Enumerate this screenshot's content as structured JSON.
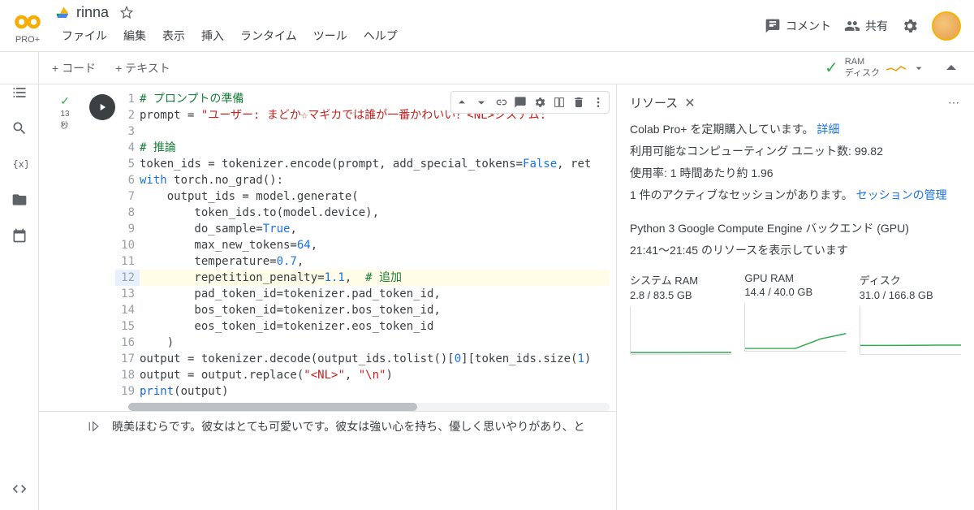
{
  "header": {
    "pro_badge": "PRO+",
    "doc_title": "rinna",
    "menus": [
      "ファイル",
      "編集",
      "表示",
      "挿入",
      "ランタイム",
      "ツール",
      "ヘルプ"
    ],
    "comment_label": "コメント",
    "share_label": "共有"
  },
  "toolbar": {
    "code_btn": "+ コード",
    "text_btn": "+ テキスト",
    "ram_label": "RAM",
    "disk_label": "ディスク"
  },
  "cell": {
    "exec_time": "13",
    "exec_unit": "秒",
    "lines": [
      {
        "n": 1,
        "html": "<span class='c-comment'># プロンプトの準備</span>"
      },
      {
        "n": 2,
        "html": "prompt = <span class='c-str'>\"ユーザー: まどか☆マギカでは誰が一番かわいい？&lt;NL&gt;システム: \"</span>"
      },
      {
        "n": 3,
        "html": ""
      },
      {
        "n": 4,
        "html": "<span class='c-comment'># 推論</span>"
      },
      {
        "n": 5,
        "html": "token_ids = tokenizer.encode(prompt, add_special_tokens=<span class='c-bool'>False</span>, ret"
      },
      {
        "n": 6,
        "html": "<span class='c-kw'>with</span> torch.no_grad():"
      },
      {
        "n": 7,
        "html": "    output_ids = model.generate("
      },
      {
        "n": 8,
        "html": "        token_ids.to(model.device),"
      },
      {
        "n": 9,
        "html": "        do_sample=<span class='c-bool'>True</span>,"
      },
      {
        "n": 10,
        "html": "        max_new_tokens=<span class='c-num'>64</span>,"
      },
      {
        "n": 11,
        "html": "        temperature=<span class='c-num'>0.7</span>,"
      },
      {
        "n": 12,
        "html": "        repetition_penalty=<span class='c-num'>1.1</span>,  <span class='c-comment'># 追加</span>",
        "hl": true
      },
      {
        "n": 13,
        "html": "        pad_token_id=tokenizer.pad_token_id,"
      },
      {
        "n": 14,
        "html": "        bos_token_id=tokenizer.bos_token_id,"
      },
      {
        "n": 15,
        "html": "        eos_token_id=tokenizer.eos_token_id"
      },
      {
        "n": 16,
        "html": "    )"
      },
      {
        "n": 17,
        "html": "output = tokenizer.decode(output_ids.tolist()[<span class='c-num'>0</span>][token_ids.size(<span class='c-num'>1</span>)"
      },
      {
        "n": 18,
        "html": "output = output.replace(<span class='c-str'>\"&lt;NL&gt;\"</span>, <span class='c-str'>\"\\n\"</span>)"
      },
      {
        "n": 19,
        "html": "<span class='c-fn'>print</span>(output)"
      }
    ],
    "output": "暁美ほむらです。彼女はとても可愛いです。彼女は強い心を持ち、優しく思いやりがあり、と"
  },
  "resources": {
    "title": "リソース",
    "sub_line": "Colab Pro+ を定期購入しています。",
    "details_link": "詳細",
    "units_line": "利用可能なコンピューティング ユニット数: 99.82",
    "usage_line": "使用率: 1 時間あたり約 1.96",
    "sessions_line": "1 件のアクティブなセッションがあります。",
    "sessions_link": "セッションの管理",
    "backend_line": "Python 3 Google Compute Engine バックエンド (GPU)",
    "time_line": "21:41～21:45 のリソースを表示しています",
    "charts": [
      {
        "label": "システム RAM",
        "value": "2.8 / 83.5 GB"
      },
      {
        "label": "GPU RAM",
        "value": "14.4 / 40.0 GB"
      },
      {
        "label": "ディスク",
        "value": "31.0 / 166.8 GB"
      }
    ]
  },
  "chart_data": [
    {
      "type": "line",
      "title": "システム RAM",
      "ylabel": "GB",
      "ylim": [
        0,
        83.5
      ],
      "x": [
        0,
        1,
        2,
        3,
        4
      ],
      "values": [
        2.6,
        2.7,
        2.7,
        2.8,
        2.8
      ]
    },
    {
      "type": "line",
      "title": "GPU RAM",
      "ylabel": "GB",
      "ylim": [
        0,
        40.0
      ],
      "x": [
        0,
        1,
        2,
        3,
        4
      ],
      "values": [
        2,
        2,
        2,
        10,
        14.4
      ]
    },
    {
      "type": "line",
      "title": "ディスク",
      "ylabel": "GB",
      "ylim": [
        0,
        166.8
      ],
      "x": [
        0,
        1,
        2,
        3,
        4
      ],
      "values": [
        30,
        30,
        30.5,
        31,
        31
      ]
    }
  ]
}
